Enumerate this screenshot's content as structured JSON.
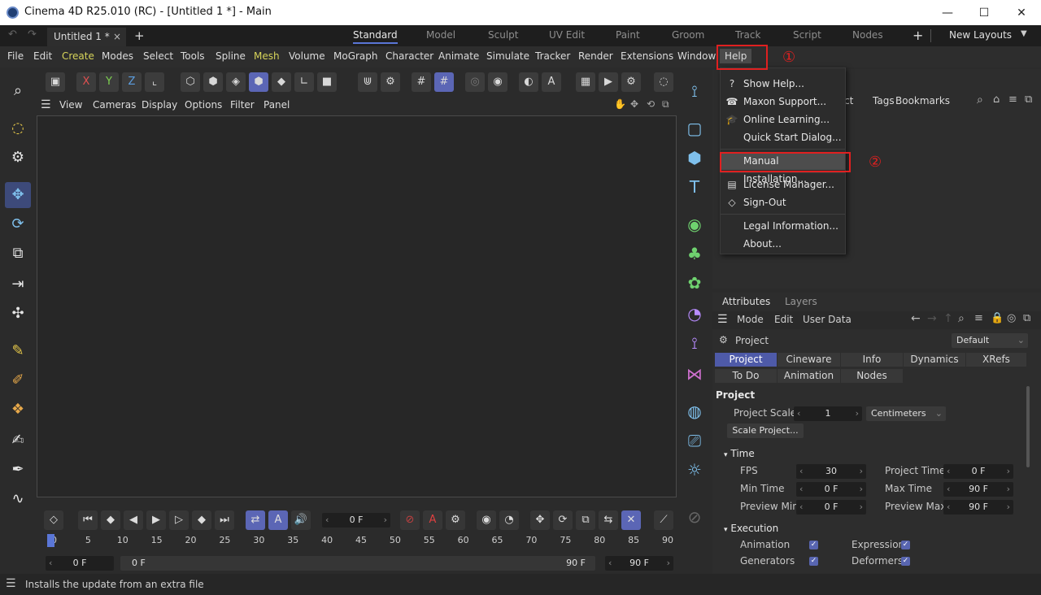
{
  "window": {
    "title": "Cinema 4D R25.010 (RC) - [Untitled 1 *] - Main",
    "minimize": "—",
    "maximize": "☐",
    "close": "✕"
  },
  "doc_tab": {
    "label": "Untitled 1 *",
    "close": "×",
    "add": "+"
  },
  "layouts": {
    "tabs": [
      "Standard",
      "Model",
      "Sculpt",
      "UV Edit",
      "Paint",
      "Groom",
      "Track",
      "Script",
      "Nodes"
    ],
    "add": "+",
    "new_layouts": "New Layouts"
  },
  "menubar": [
    "File",
    "Edit",
    "Create",
    "Modes",
    "Select",
    "Tools",
    "Spline",
    "Mesh",
    "Volume",
    "MoGraph",
    "Character",
    "Animate",
    "Simulate",
    "Tracker",
    "Render",
    "Extensions",
    "Window",
    "Help"
  ],
  "viewport_menu": [
    "View",
    "Cameras",
    "Display",
    "Options",
    "Filter",
    "Panel"
  ],
  "toolbar_axes": [
    "X",
    "Y",
    "Z"
  ],
  "object_panel_menu": [
    "ct",
    "Tags",
    "Bookmarks"
  ],
  "help_menu": {
    "items": [
      {
        "label": "Show Help...",
        "icon": "?"
      },
      {
        "label": "Maxon Support...",
        "icon": "☎"
      },
      {
        "label": "Online Learning...",
        "icon": "🎓"
      },
      {
        "label": "Quick Start Dialog...",
        "icon": ""
      },
      {
        "label": "Manual Installation...",
        "icon": ""
      },
      {
        "label": "License Manager...",
        "icon": "▤"
      },
      {
        "label": "Sign-Out",
        "icon": "◇"
      },
      {
        "label": "Legal Information...",
        "icon": ""
      },
      {
        "label": "About...",
        "icon": ""
      }
    ]
  },
  "annotations": {
    "step1": "①",
    "step2": "②"
  },
  "attributes": {
    "tabs": [
      "Attributes",
      "Layers"
    ],
    "menu": [
      "Mode",
      "Edit",
      "User Data"
    ],
    "object_label": "Project",
    "preset": "Default",
    "project_tabs_row1": [
      "Project",
      "Cineware",
      "Info",
      "Dynamics",
      "XRefs"
    ],
    "project_tabs_row2": [
      "To Do",
      "Animation",
      "Nodes"
    ],
    "section_project": "Project",
    "project_scale_label": "Project Scale",
    "project_scale_value": "1",
    "project_scale_unit": "Centimeters",
    "scale_project_button": "Scale Project...",
    "section_time": "Time",
    "fps_label": "FPS",
    "fps_value": "30",
    "project_time_label": "Project Time",
    "project_time_value": "0 F",
    "min_time_label": "Min Time",
    "min_time_value": "0 F",
    "max_time_label": "Max Time",
    "max_time_value": "90 F",
    "preview_min_label": "Preview Min",
    "preview_min_value": "0 F",
    "preview_max_label": "Preview Max",
    "preview_max_value": "90 F",
    "section_execution": "Execution",
    "animation_label": "Animation",
    "expression_label": "Expression",
    "generators_label": "Generators",
    "deformers_label": "Deformers"
  },
  "timeline": {
    "current_frame": "0 F",
    "ticks": [
      "0",
      "5",
      "10",
      "15",
      "20",
      "25",
      "30",
      "35",
      "40",
      "45",
      "50",
      "55",
      "60",
      "65",
      "70",
      "75",
      "80",
      "85",
      "90"
    ],
    "start_field": "0 F",
    "range_start": "0 F",
    "range_end": "90 F",
    "end_field": "90 F"
  },
  "status": {
    "text": "Installs the update from an extra file"
  }
}
